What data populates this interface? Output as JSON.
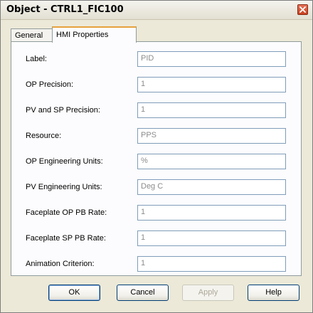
{
  "window": {
    "title": "Object - CTRL1_FIC100"
  },
  "tabs": [
    {
      "label": "General",
      "active": false
    },
    {
      "label": "HMI Properties",
      "active": true
    }
  ],
  "fields": [
    {
      "label": "Label:",
      "value": "PID"
    },
    {
      "label": "OP Precision:",
      "value": "1"
    },
    {
      "label": "PV and SP Precision:",
      "value": "1"
    },
    {
      "label": "Resource:",
      "value": "PPS"
    },
    {
      "label": "OP Engineering Units:",
      "value": "%"
    },
    {
      "label": "PV Engineering Units:",
      "value": "Deg C"
    },
    {
      "label": "Faceplate OP PB Rate:",
      "value": "1"
    },
    {
      "label": "Faceplate SP PB Rate:",
      "value": "1"
    },
    {
      "label": "Animation Criterion:",
      "value": "1"
    }
  ],
  "buttons": {
    "ok": "OK",
    "cancel": "Cancel",
    "apply": "Apply",
    "help": "Help"
  },
  "colors": {
    "window_bg": "#ece9d8",
    "panel_bg": "#fcfcfe",
    "field_border": "#7f9db9",
    "active_tab_accent": "#e6a23c",
    "close_button": "#c8401e"
  },
  "icons": {
    "close": "close-icon"
  }
}
